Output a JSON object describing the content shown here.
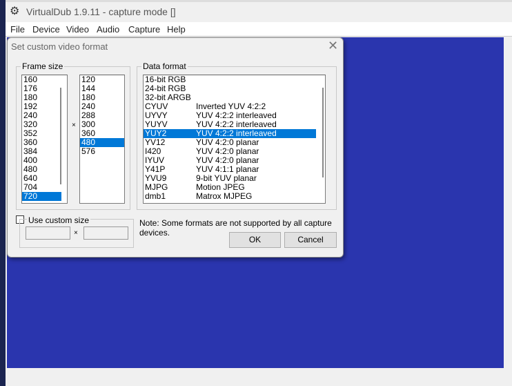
{
  "window": {
    "title": "VirtualDub 1.9.11 - capture mode []",
    "icon": "gear-film-icon"
  },
  "menu": [
    "File",
    "Device",
    "Video",
    "Audio",
    "Capture",
    "Help"
  ],
  "colors": {
    "canvas": "#2a35ae",
    "selection": "#0078d7"
  },
  "dialog": {
    "title": "Set custom video format",
    "frame_size": {
      "label": "Frame size",
      "widths": [
        "160",
        "176",
        "180",
        "192",
        "240",
        "320",
        "352",
        "360",
        "384",
        "400",
        "480",
        "640",
        "704",
        "720"
      ],
      "selected_width": "720",
      "times": "×",
      "heights": [
        "120",
        "144",
        "180",
        "240",
        "288",
        "300",
        "360",
        "480",
        "576"
      ],
      "selected_height": "480"
    },
    "custom": {
      "label": "Use custom size",
      "checked": false,
      "times": "×",
      "width": "",
      "height": ""
    },
    "data_format": {
      "label": "Data format",
      "items": [
        [
          "16-bit RGB",
          ""
        ],
        [
          "24-bit RGB",
          ""
        ],
        [
          "32-bit ARGB",
          ""
        ],
        [
          "CYUV",
          "Inverted YUV 4:2:2"
        ],
        [
          "UYVY",
          "YUV 4:2:2 interleaved"
        ],
        [
          "YUYV",
          "YUV 4:2:2 interleaved"
        ],
        [
          "YUY2",
          "YUV 4:2:2 interleaved"
        ],
        [
          "YV12",
          "YUV 4:2:0 planar"
        ],
        [
          "I420",
          "YUV 4:2:0 planar"
        ],
        [
          "IYUV",
          "YUV 4:2:0 planar"
        ],
        [
          "Y41P",
          "YUV 4:1:1 planar"
        ],
        [
          "YVU9",
          "9-bit YUV planar"
        ],
        [
          "MJPG",
          "Motion JPEG"
        ],
        [
          "dmb1",
          "Matrox MJPEG"
        ]
      ],
      "selected": "YUY2"
    },
    "note": "Note: Some formats are not supported by all capture devices.",
    "ok": "OK",
    "cancel": "Cancel"
  }
}
